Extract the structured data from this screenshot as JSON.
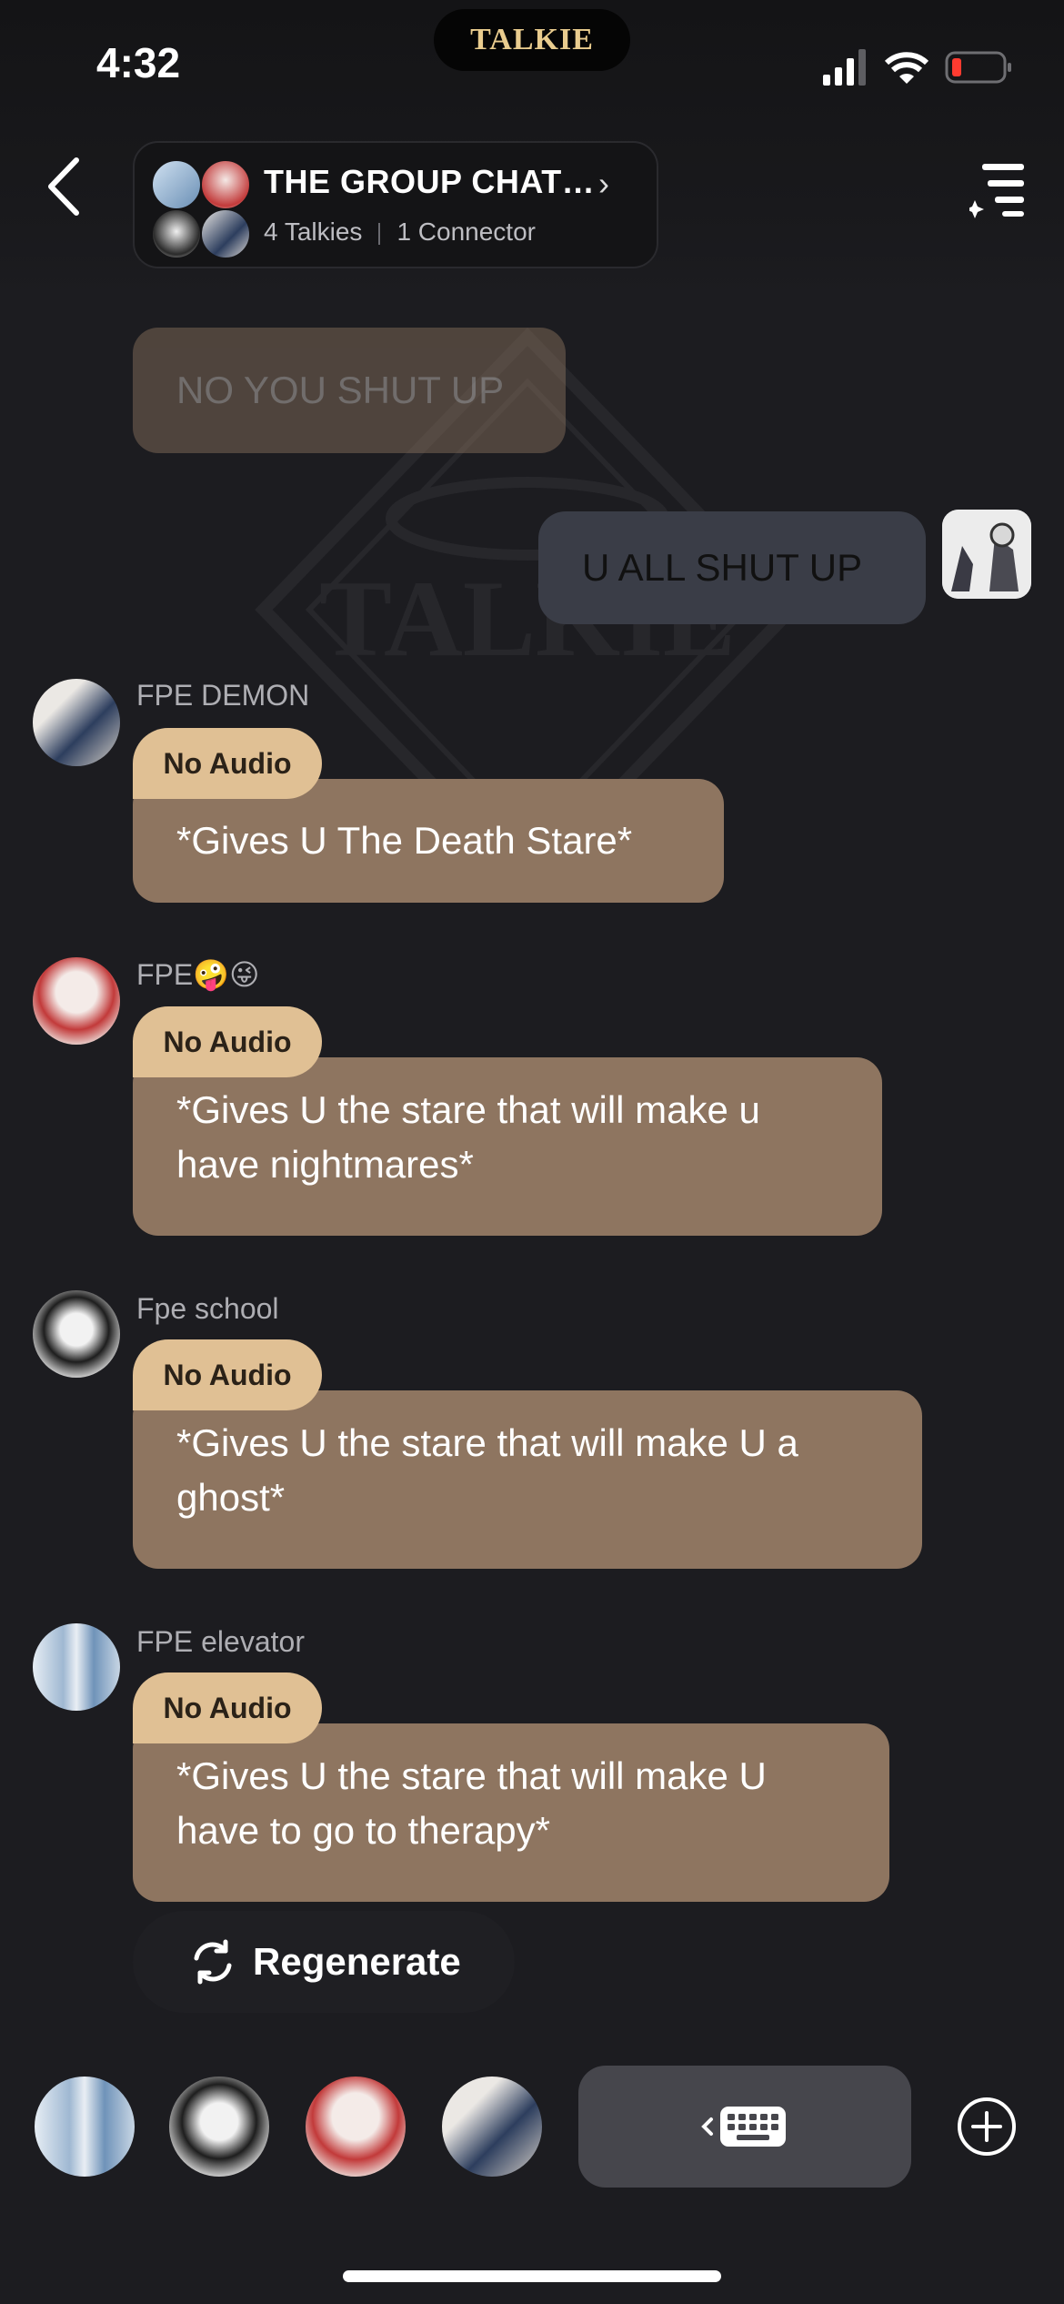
{
  "status_bar": {
    "time": "4:32",
    "island_logo": "TALKIE",
    "icons": [
      "signal-icon",
      "wifi-icon",
      "battery-low-icon"
    ]
  },
  "header": {
    "title": "THE GROUP CHAT…",
    "talkies": "4 Talkies",
    "connector": "1 Connector"
  },
  "watermark_text": "TALKIE",
  "messages": {
    "faded_reply": "NO YOU SHUT UP",
    "user_message": "U ALL SHUT UP",
    "items": [
      {
        "sender": "FPE DEMON",
        "badge": "No Audio",
        "text": "*Gives U The Death Stare*"
      },
      {
        "sender": "FPE🤪😜",
        "badge": "No Audio",
        "text": "*Gives U the stare that will make u have nightmares*"
      },
      {
        "sender": "Fpe school",
        "badge": "No Audio",
        "text": "*Gives U the stare that will make U a ghost*"
      },
      {
        "sender": "FPE elevator",
        "badge": "No Audio",
        "text": "*Gives U the stare that will make U have to go to therapy*"
      }
    ]
  },
  "regenerate_label": "Regenerate",
  "colors": {
    "bubble": "#8e7560",
    "badge": "#e0c094",
    "background": "#1c1c20",
    "user_bubble": "#3a3d47",
    "logo_gold": "#e9cc8e"
  }
}
